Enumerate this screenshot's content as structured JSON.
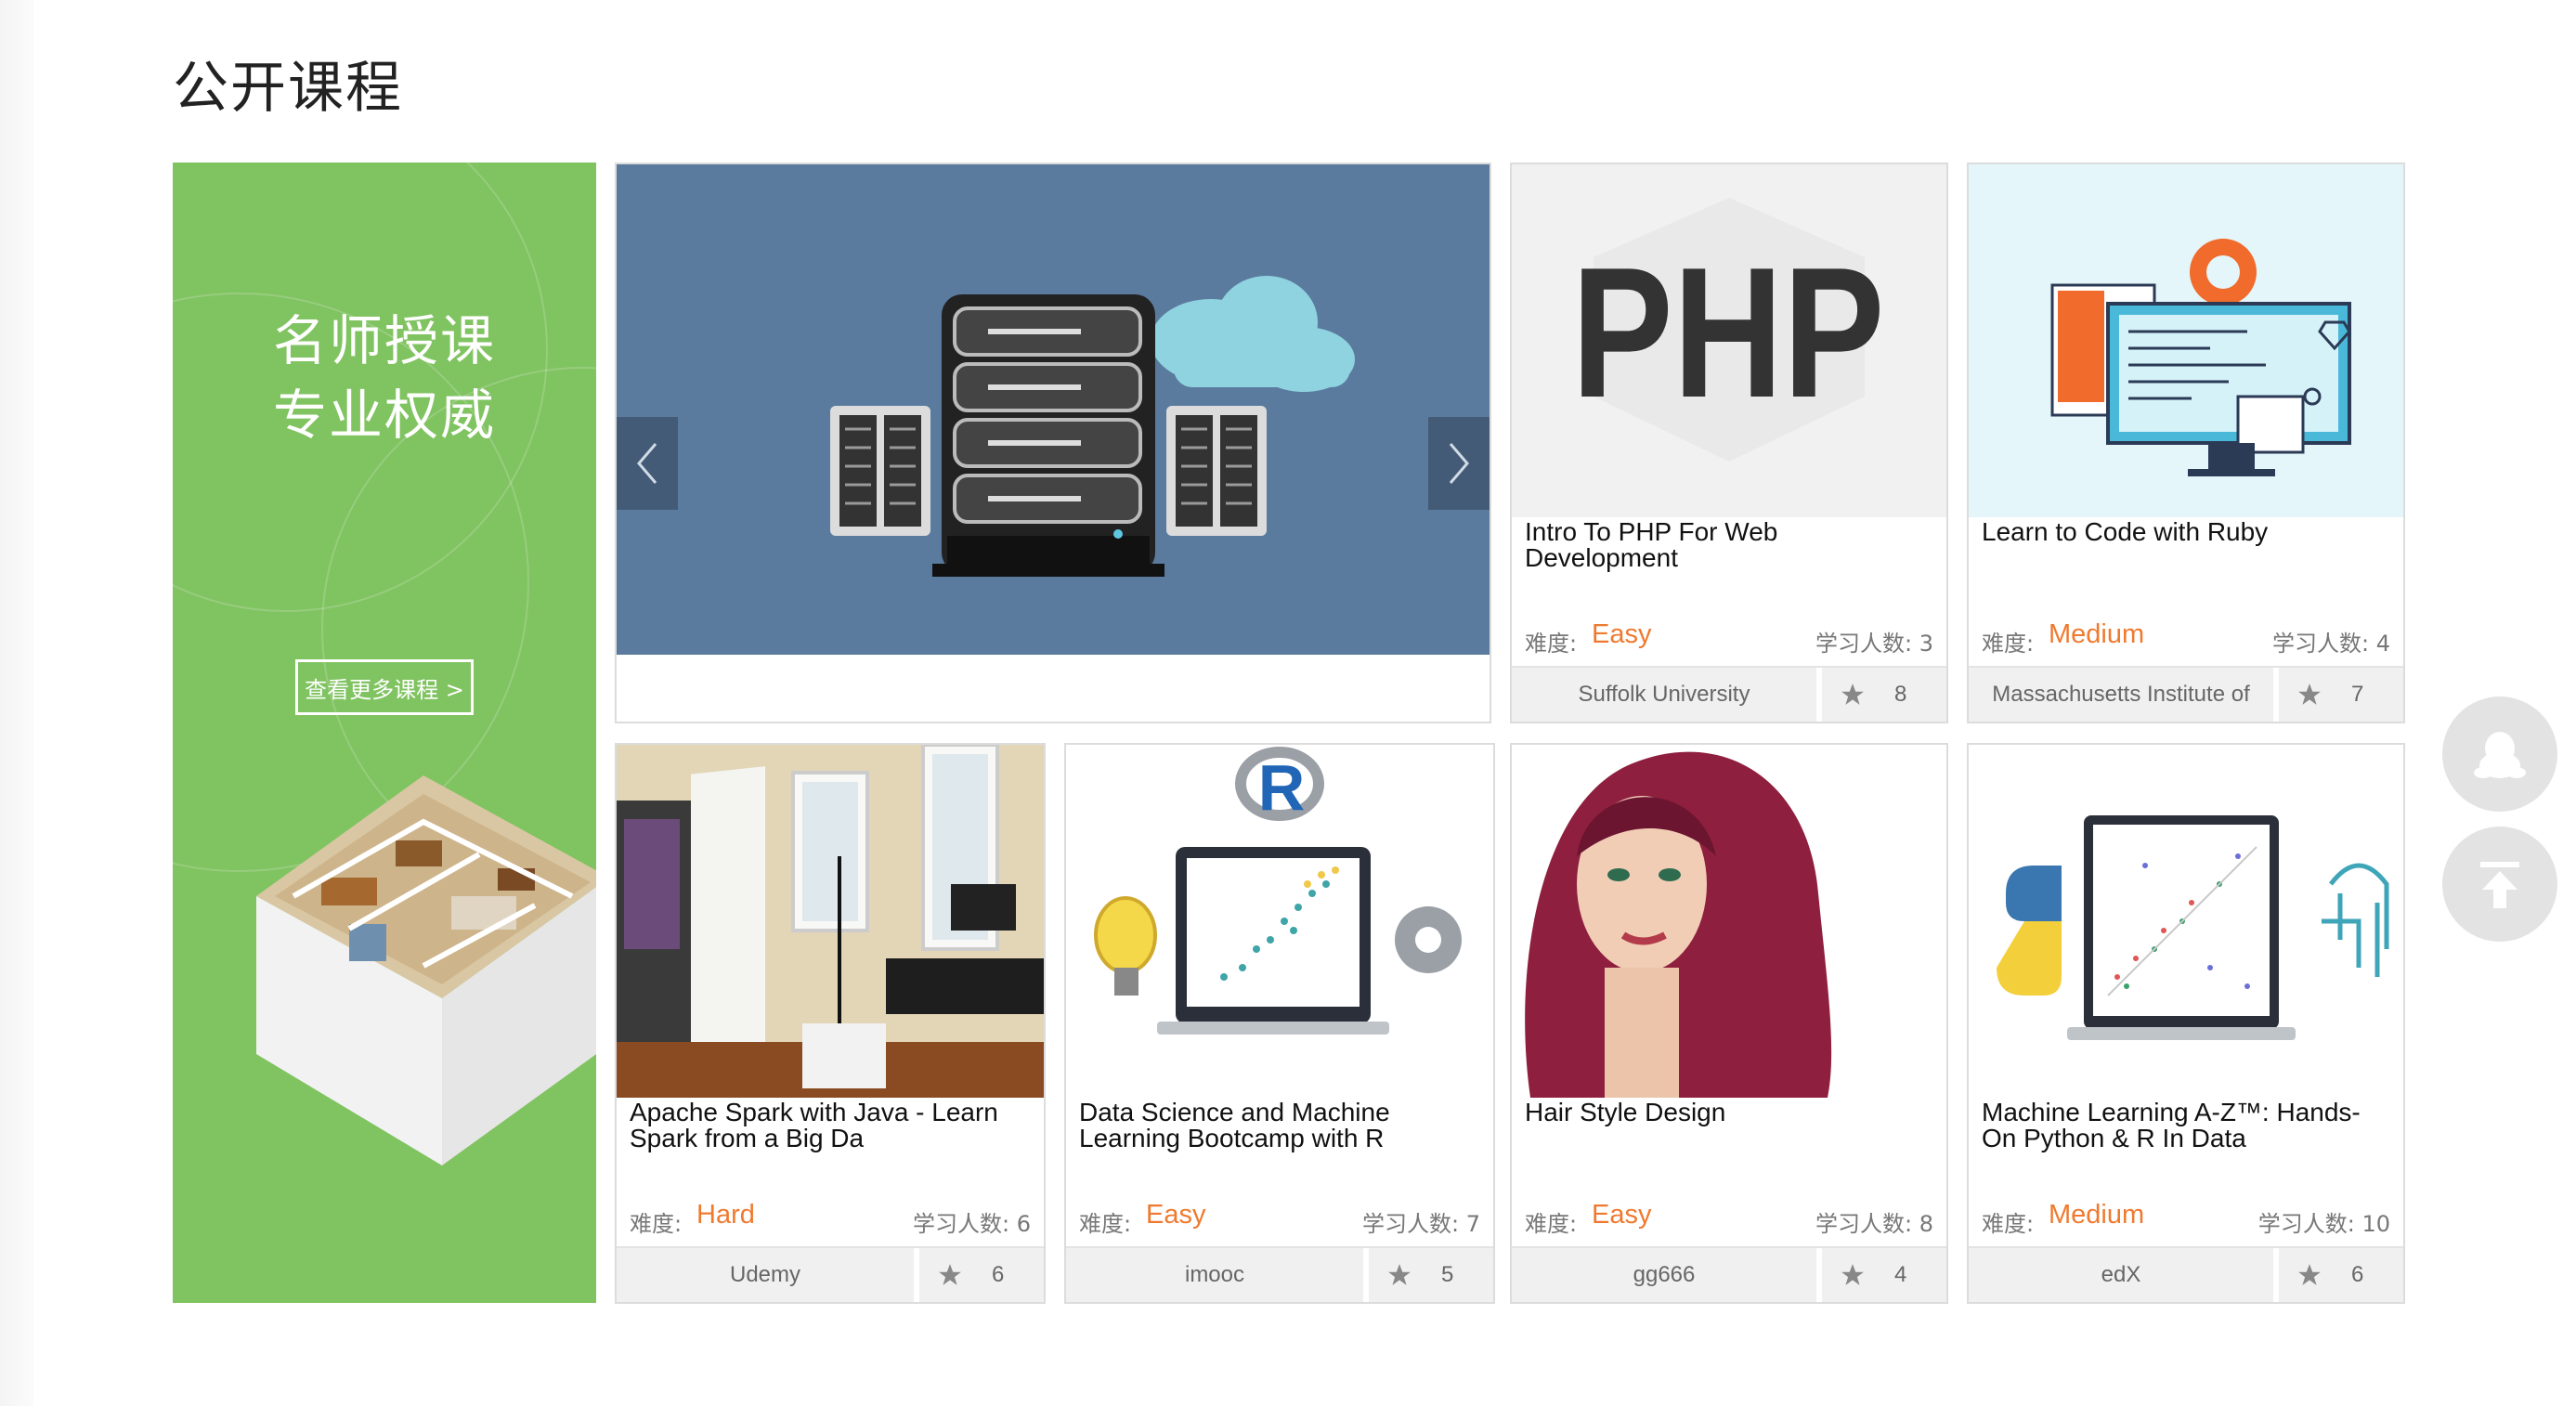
{
  "section": {
    "title": "公开课程"
  },
  "promo": {
    "line1": "名师授课",
    "line2": "专业权威",
    "button_label": "查看更多课程 >"
  },
  "slider": {
    "prev_icon": "chevron-left-icon",
    "next_icon": "chevron-right-icon"
  },
  "labels": {
    "difficulty": "难度:",
    "learners": "学习人数:"
  },
  "courses": [
    {
      "title": "Intro To PHP For Web Development",
      "difficulty": "Easy",
      "learners": "3",
      "institution": "Suffolk University",
      "rating": "8",
      "thumb_text": "PHP"
    },
    {
      "title": "Learn to Code with Ruby",
      "difficulty": "Medium",
      "learners": "4",
      "institution": "Massachusetts Institute of",
      "rating": "7"
    },
    {
      "title": "Apache Spark with Java - Learn Spark from a Big Da",
      "difficulty": "Hard",
      "learners": "6",
      "institution": "Udemy",
      "rating": "6"
    },
    {
      "title": "Data Science and Machine Learning Bootcamp with R",
      "difficulty": "Easy",
      "learners": "7",
      "institution": "imooc",
      "rating": "5",
      "thumb_text": "R"
    },
    {
      "title": "Hair Style Design",
      "difficulty": "Easy",
      "learners": "8",
      "institution": "gg666",
      "rating": "4"
    },
    {
      "title": "Machine Learning A-Z™: Hands-On Python & R In Data",
      "difficulty": "Medium",
      "learners": "10",
      "institution": "edX",
      "rating": "6"
    }
  ],
  "floating": {
    "qq_icon": "qq-penguin-icon",
    "top_icon": "back-to-top-icon"
  },
  "colors": {
    "promo_green": "#80c361",
    "difficulty_orange": "#ef7a2f",
    "banner_blue": "#5a7b9e"
  }
}
